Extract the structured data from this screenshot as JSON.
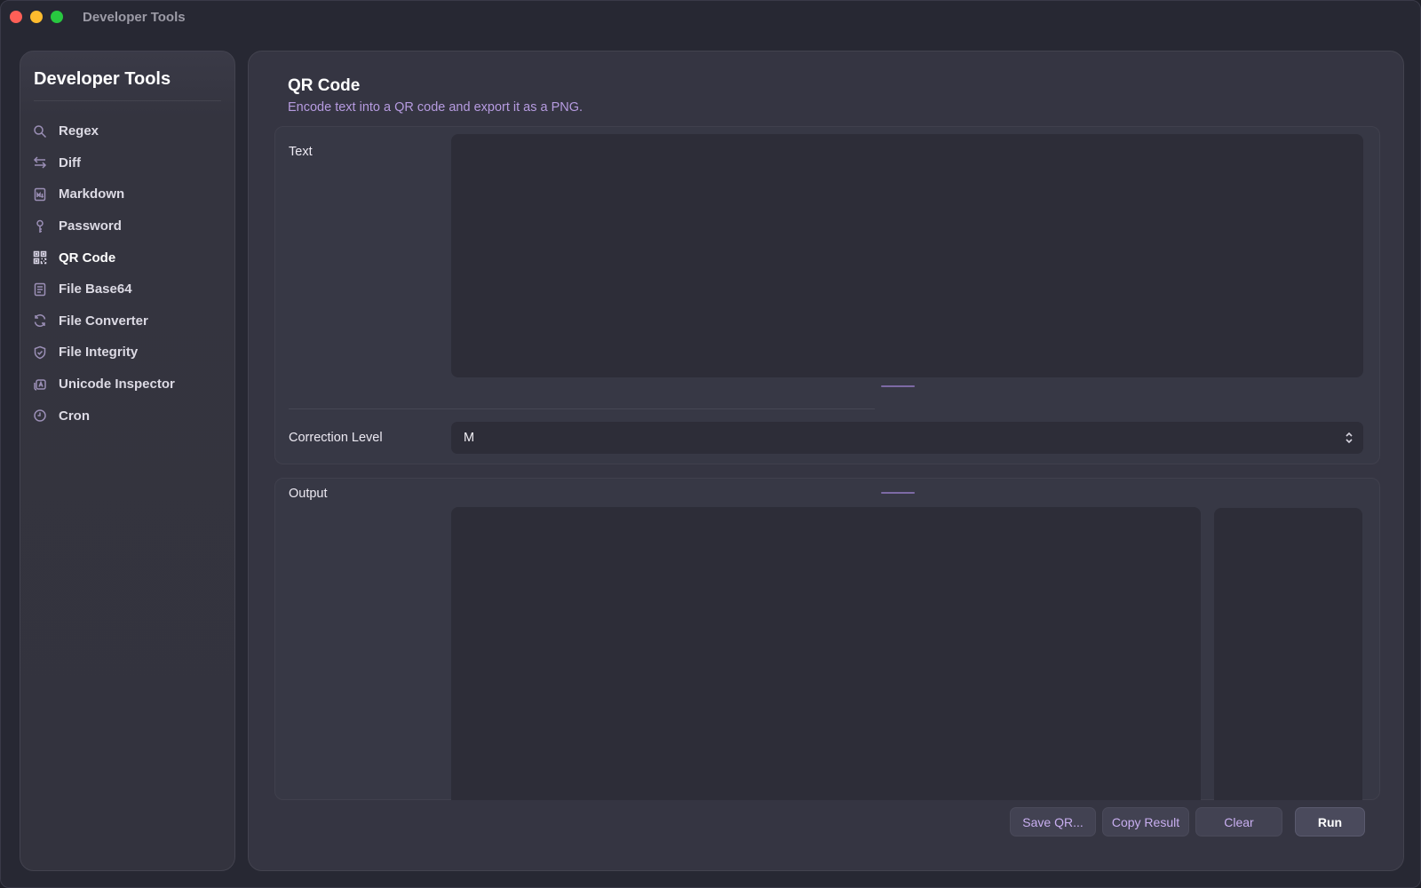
{
  "window": {
    "title": "Developer Tools"
  },
  "sidebar": {
    "title": "Developer Tools",
    "items": [
      {
        "label": "Regex",
        "icon": "search-icon"
      },
      {
        "label": "Diff",
        "icon": "swap-arrows-icon"
      },
      {
        "label": "Markdown",
        "icon": "markdown-doc-icon"
      },
      {
        "label": "Password",
        "icon": "key-icon"
      },
      {
        "label": "QR Code",
        "icon": "qr-code-icon",
        "active": true
      },
      {
        "label": "File Base64",
        "icon": "file-icon"
      },
      {
        "label": "File Converter",
        "icon": "refresh-icon"
      },
      {
        "label": "File Integrity",
        "icon": "shield-check-icon"
      },
      {
        "label": "Unicode Inspector",
        "icon": "glyph-icon"
      },
      {
        "label": "Cron",
        "icon": "clock-icon"
      }
    ]
  },
  "main": {
    "title": "QR Code",
    "subtitle": "Encode text into a QR code and export it as a PNG.",
    "text_label": "Text",
    "text_value": "",
    "correction_label": "Correction Level",
    "correction_value": "M",
    "output_label": "Output"
  },
  "buttons": {
    "save": "Save QR...",
    "copy": "Copy Result",
    "clear": "Clear",
    "run": "Run"
  },
  "colors": {
    "accent": "#b69be0",
    "window_bg": "#272833",
    "panel_bg": "#353542",
    "field_bg": "#2d2d38"
  }
}
